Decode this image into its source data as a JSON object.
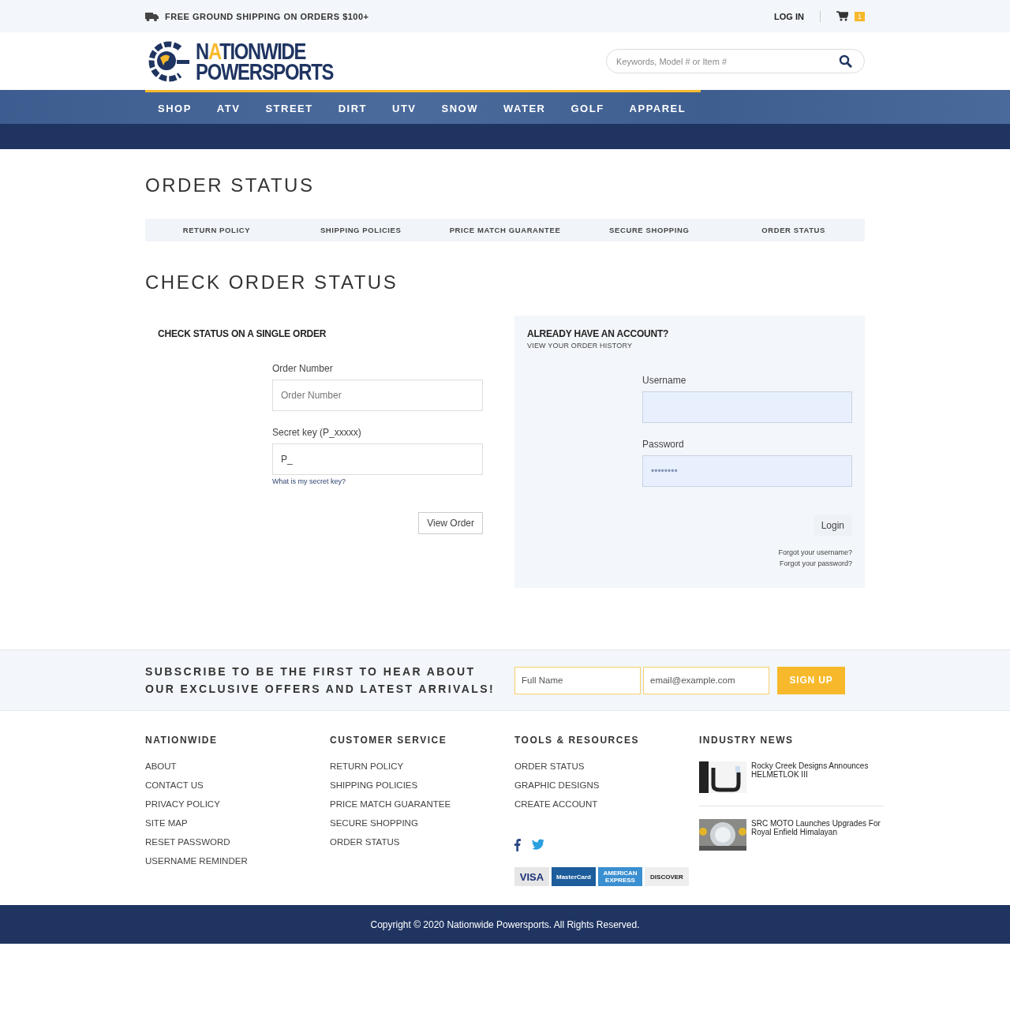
{
  "top_bar": {
    "shipping": "FREE GROUND SHIPPING ON ORDERS $100+",
    "login": "LOG IN",
    "cart_count": "1"
  },
  "header": {
    "logo": {
      "line_1_lead": "N",
      "line_1_accent": "A",
      "line_1_rest": "TIONWIDE",
      "line_2": "POWERSPORTS"
    },
    "search": {
      "placeholder": "Keywords, Model # or Item #"
    }
  },
  "nav": [
    "SHOP",
    "ATV",
    "STREET",
    "DIRT",
    "UTV",
    "SNOW",
    "WATER",
    "GOLF",
    "APPAREL"
  ],
  "page_title": "ORDER STATUS",
  "tabs": [
    "RETURN POLICY",
    "SHIPPING POLICIES",
    "PRICE MATCH GUARANTEE",
    "SECURE SHOPPING",
    "ORDER STATUS"
  ],
  "section_title": "CHECK ORDER STATUS",
  "single_order": {
    "title": "CHECK STATUS ON A SINGLE ORDER",
    "fields": [
      {
        "label": "Order Number",
        "placeholder": "Order Number"
      },
      {
        "label": "Secret key (P_xxxxx)",
        "value": "P_",
        "help": "What is my secret key?"
      }
    ],
    "button": "View Order"
  },
  "account": {
    "title": "ALREADY HAVE AN ACCOUNT?",
    "subtitle": "VIEW YOUR ORDER HISTORY",
    "fields": [
      {
        "label": "Username"
      },
      {
        "label": "Password",
        "value": "••••••••"
      }
    ],
    "button": "Login",
    "links": [
      "Forgot your username?",
      "Forgot your password?"
    ]
  },
  "subscribe": {
    "text_lines": [
      "SUBSCRIBE TO BE THE FIRST TO HEAR ABOUT",
      "OUR EXCLUSIVE OFFERS AND LATEST ARRIVALS!"
    ],
    "name_placeholder": "Full Name",
    "email_placeholder": "email@example.com",
    "button": "SIGN UP"
  },
  "footer": {
    "columns": [
      {
        "title": "NATIONWIDE",
        "links": [
          "ABOUT",
          "CONTACT US",
          "PRIVACY POLICY",
          "SITE MAP",
          "RESET PASSWORD",
          "USERNAME REMINDER"
        ]
      },
      {
        "title": "CUSTOMER SERVICE",
        "links": [
          "RETURN POLICY",
          "SHIPPING POLICIES",
          "PRICE MATCH GUARANTEE",
          "SECURE SHOPPING",
          "ORDER STATUS"
        ]
      },
      {
        "title": "TOOLS & RESOURCES",
        "links": [
          "ORDER STATUS",
          "GRAPHIC DESIGNS",
          "CREATE ACCOUNT"
        ]
      }
    ],
    "payment_cards": [
      {
        "kind": "visa",
        "label": "VISA"
      },
      {
        "kind": "mastercard",
        "label": "MasterCard"
      },
      {
        "kind": "amex",
        "label": "AMERICAN EXPRESS"
      },
      {
        "kind": "discover",
        "label": "DISCOVER"
      }
    ],
    "news": {
      "title": "INDUSTRY NEWS",
      "items": [
        {
          "headline": "Rocky Creek Designs Announces HELMETLOK III"
        },
        {
          "headline": "SRC MOTO Launches Upgrades For Royal Enfield Himalayan"
        }
      ]
    }
  },
  "copyright": "Copyright © 2020 Nationwide Powersports. All Rights Reserved."
}
